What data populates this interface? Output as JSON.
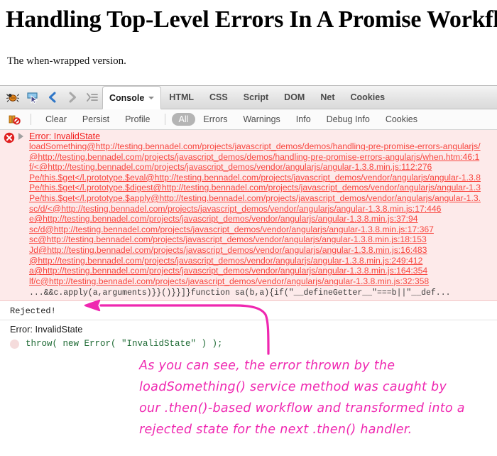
{
  "article": {
    "title": "Handling Top-Level Errors In A Promise Workflow",
    "subtitle": "The when-wrapped version."
  },
  "firebug": {
    "toolbar_icons": [
      {
        "name": "firebug-bug-icon",
        "label": "Firebug"
      },
      {
        "name": "inspect-element-icon",
        "label": "Inspect Element"
      },
      {
        "name": "back-arrow-icon",
        "label": "Back"
      },
      {
        "name": "forward-arrow-icon",
        "label": "Forward"
      },
      {
        "name": "panel-menu-icon",
        "label": "Panel Menu"
      }
    ],
    "tabs": [
      {
        "label": "Console",
        "active": true,
        "has_menu": true
      },
      {
        "label": "HTML",
        "active": false
      },
      {
        "label": "CSS",
        "active": false
      },
      {
        "label": "Script",
        "active": false
      },
      {
        "label": "DOM",
        "active": false
      },
      {
        "label": "Net",
        "active": false
      },
      {
        "label": "Cookies",
        "active": false
      }
    ],
    "options": [
      {
        "label": "Clear",
        "selected": false
      },
      {
        "label": "Persist",
        "selected": false
      },
      {
        "label": "Profile",
        "selected": false
      },
      {
        "label": "All",
        "selected": true
      },
      {
        "label": "Errors",
        "selected": false
      },
      {
        "label": "Warnings",
        "selected": false
      },
      {
        "label": "Info",
        "selected": false
      },
      {
        "label": "Debug Info",
        "selected": false
      },
      {
        "label": "Cookies",
        "selected": false
      }
    ],
    "break_on_error_icon": "break-on-error-icon"
  },
  "console": {
    "error_entry": {
      "title": "Error: InvalidState",
      "stack": [
        "loadSomething@http://testing.bennadel.com/projects/javascript_demos/demos/handling-pre-promise-errors-angularjs/",
        "@http://testing.bennadel.com/projects/javascript_demos/demos/handling-pre-promise-errors-angularjs/when.htm:46:1",
        "f/<@http://testing.bennadel.com/projects/javascript_demos/vendor/angularjs/angular-1.3.8.min.js:112:276",
        "Pe/this.$get</l.prototype.$eval@http://testing.bennadel.com/projects/javascript_demos/vendor/angularjs/angular-1.3.8",
        "Pe/this.$get</l.prototype.$digest@http://testing.bennadel.com/projects/javascript_demos/vendor/angularjs/angular-1.3",
        "Pe/this.$get</l.prototype.$apply@http://testing.bennadel.com/projects/javascript_demos/vendor/angularjs/angular-1.3.",
        "sc/d/<@http://testing.bennadel.com/projects/javascript_demos/vendor/angularjs/angular-1.3.8.min.js:17:446",
        "e@http://testing.bennadel.com/projects/javascript_demos/vendor/angularjs/angular-1.3.8.min.js:37:94",
        "sc/d@http://testing.bennadel.com/projects/javascript_demos/vendor/angularjs/angular-1.3.8.min.js:17:367",
        "sc@http://testing.bennadel.com/projects/javascript_demos/vendor/angularjs/angular-1.3.8.min.js:18:153",
        "Jd@http://testing.bennadel.com/projects/javascript_demos/vendor/angularjs/angular-1.3.8.min.js:16:483",
        "@http://testing.bennadel.com/projects/javascript_demos/vendor/angularjs/angular-1.3.8.min.js:249:412",
        "a@http://testing.bennadel.com/projects/javascript_demos/vendor/angularjs/angular-1.3.8.min.js:164:354",
        "lf/c@http://testing.bennadel.com/projects/javascript_demos/vendor/angularjs/angular-1.3.8.min.js:32:358"
      ],
      "tail": "...&&c.apply(a,arguments)}}()}}]}function sa(b,a){if(\"__defineGetter__\"===b||\"__def..."
    },
    "rejected_label": "Rejected!",
    "rejected_error": "Error: InvalidState",
    "rejected_code": "throw( new Error( \"InvalidState\" ) );"
  },
  "annotation": {
    "color": "#ef27b0",
    "lines": [
      "As you can see, the error thrown by the",
      "loadSomething() service method was caught by",
      "our .then()-based workflow and transformed into a",
      "rejected state for the next .then() handler."
    ]
  }
}
